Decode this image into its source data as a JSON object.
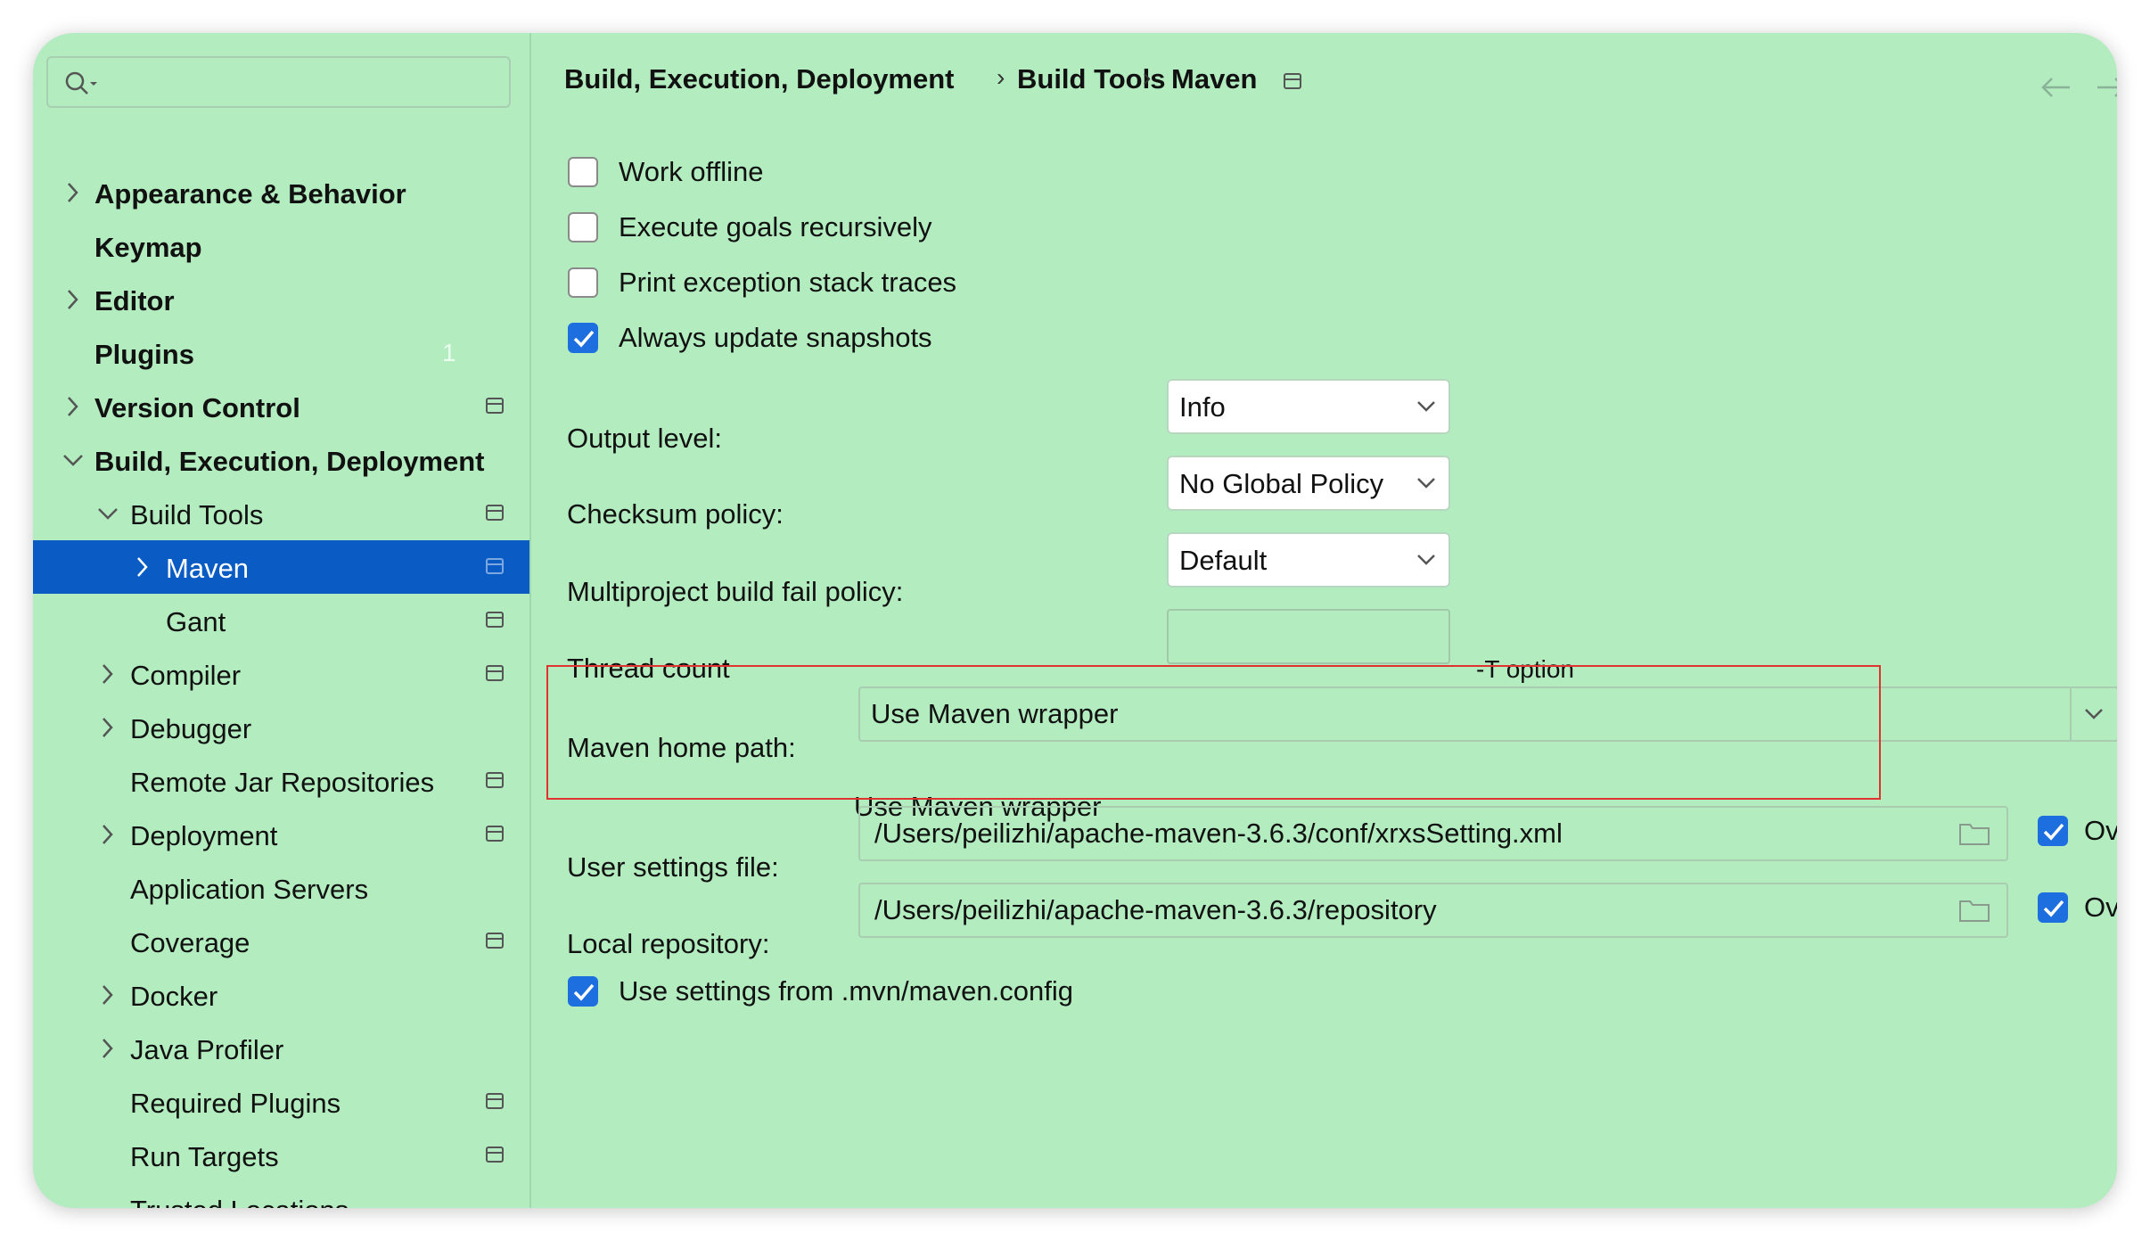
{
  "sidebar": {
    "search": {
      "placeholder": ""
    },
    "items": [
      {
        "label": "Appearance & Behavior",
        "badge": ""
      },
      {
        "label": "Keymap",
        "badge": ""
      },
      {
        "label": "Editor",
        "badge": ""
      },
      {
        "label": "Plugins",
        "badge": "1"
      },
      {
        "label": "Version Control",
        "badge": ""
      },
      {
        "label": "Build, Execution, Deployment",
        "badge": ""
      },
      {
        "label": "Build Tools",
        "badge": ""
      },
      {
        "label": "Maven",
        "badge": ""
      },
      {
        "label": "Gant",
        "badge": ""
      },
      {
        "label": "Compiler",
        "badge": ""
      },
      {
        "label": "Debugger",
        "badge": ""
      },
      {
        "label": "Remote Jar Repositories",
        "badge": ""
      },
      {
        "label": "Deployment",
        "badge": ""
      },
      {
        "label": "Application Servers",
        "badge": ""
      },
      {
        "label": "Coverage",
        "badge": ""
      },
      {
        "label": "Docker",
        "badge": ""
      },
      {
        "label": "Java Profiler",
        "badge": ""
      },
      {
        "label": "Required Plugins",
        "badge": ""
      },
      {
        "label": "Run Targets",
        "badge": ""
      },
      {
        "label": "Trusted Locations",
        "badge": ""
      }
    ]
  },
  "breadcrumb": {
    "items": [
      "Build, Execution, Deployment",
      "Build Tools",
      "Maven"
    ],
    "separator": "›"
  },
  "options": {
    "work_offline": {
      "label": "Work offline",
      "checked": false
    },
    "execute_goals_recursively": {
      "label": "Execute goals recursively",
      "checked": false
    },
    "print_exception_stack_traces": {
      "label": "Print exception stack traces",
      "checked": false
    },
    "always_update_snapshots": {
      "label": "Always update snapshots",
      "checked": true
    },
    "use_settings_mvn_config": {
      "label": "Use settings from .mvn/maven.config",
      "checked": true
    }
  },
  "form": {
    "output_level": {
      "label": "Output level:",
      "value": "Info"
    },
    "checksum_policy": {
      "label": "Checksum policy:",
      "value": "No Global Policy"
    },
    "multiproject_fail_policy": {
      "label": "Multiproject build fail policy:",
      "value": "Default"
    },
    "thread_count": {
      "label": "Thread count",
      "value": "",
      "hint": "-T option"
    },
    "maven_home_path": {
      "label": "Maven home path:",
      "value": "Use Maven wrapper",
      "detail": "Use Maven wrapper"
    },
    "user_settings_file": {
      "label": "User settings file:",
      "value": "/Users/peilizhi/apache-maven-3.6.3/conf/xrxsSetting.xml",
      "override_label": "Overr",
      "override_checked": true
    },
    "local_repository": {
      "label": "Local repository:",
      "value": "/Users/peilizhi/apache-maven-3.6.3/repository",
      "override_label": "Overr",
      "override_checked": true
    }
  },
  "colors": {
    "background": "#b2ecbf",
    "selection": "#0a5bc4",
    "checkbox_checked": "#1d6fe0",
    "highlight_border": "#e0322e"
  }
}
